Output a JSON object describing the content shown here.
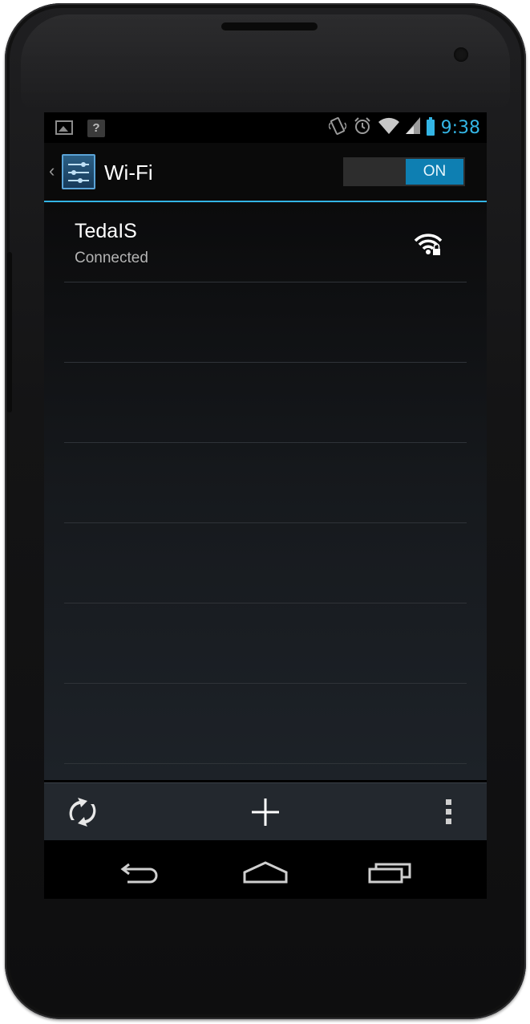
{
  "status_bar": {
    "time": "9:38",
    "icons": [
      "picture-icon",
      "unknown-app-icon",
      "vibrate-icon",
      "alarm-icon",
      "wifi-signal-icon",
      "cell-signal-icon",
      "battery-icon"
    ],
    "accent": "#33b5e5"
  },
  "action_bar": {
    "back_glyph": "‹",
    "title": "Wi-Fi",
    "toggle_label": "ON",
    "toggle_state": "on",
    "toggle_color": "#0e7fb2"
  },
  "networks": [
    {
      "name": "TedaIS",
      "status": "Connected",
      "icon": "wifi-locked-icon"
    }
  ],
  "bottom_bar": {
    "actions": [
      "wps-icon",
      "add-network-icon",
      "overflow-menu-icon"
    ]
  },
  "nav_bar": {
    "buttons": [
      "back-icon",
      "home-icon",
      "recents-icon"
    ]
  }
}
